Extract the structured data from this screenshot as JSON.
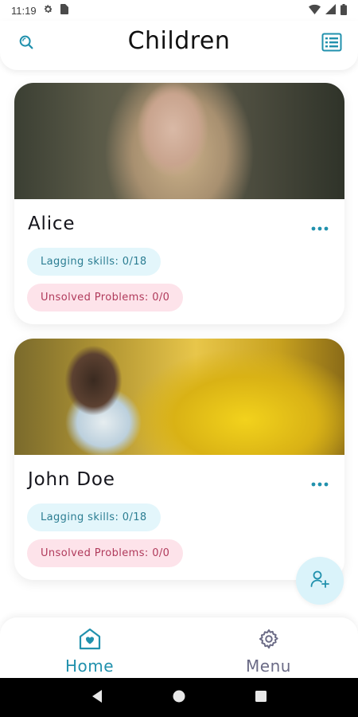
{
  "status_bar": {
    "time": "11:19"
  },
  "header": {
    "title": "Children"
  },
  "children": [
    {
      "name": "Alice",
      "lagging_skills": "Lagging skills: 0/18",
      "unsolved_problems": "Unsolved Problems: 0/0"
    },
    {
      "name": "John Doe",
      "lagging_skills": "Lagging skills: 0/18",
      "unsolved_problems": "Unsolved Problems: 0/0"
    }
  ],
  "bottom_nav": {
    "items": [
      {
        "label": "Home",
        "icon": "home-heart-icon",
        "active": true
      },
      {
        "label": "Menu",
        "icon": "gear-icon",
        "active": false
      }
    ]
  },
  "colors": {
    "accent": "#2191ad",
    "skills_bg": "#e3f6fb",
    "skills_text": "#2b7d92",
    "problems_bg": "#fde3ea",
    "problems_text": "#b03a5b",
    "fab_bg": "#daf3fa",
    "inactive_nav": "#6b6b86"
  },
  "icons": {
    "header_left": "search-icon",
    "header_right": "list-view-icon",
    "card_menu": "more-horizontal-icon",
    "fab": "add-user-icon"
  }
}
